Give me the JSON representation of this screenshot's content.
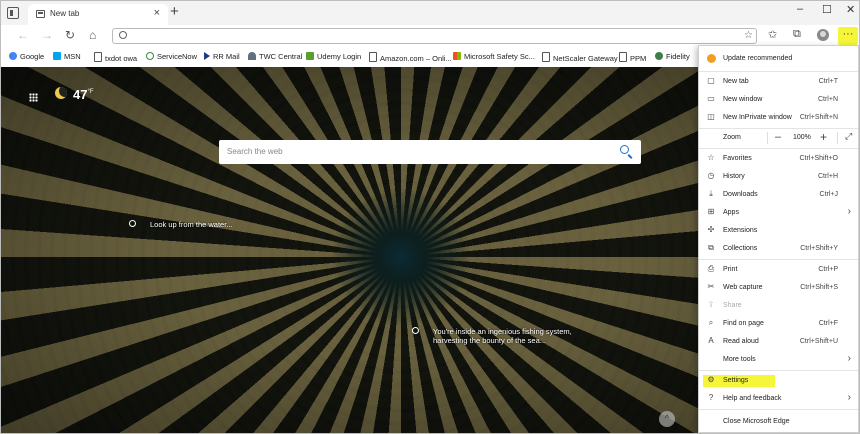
{
  "browser": {
    "tab_title": "New tab",
    "tab_close": "×",
    "new_tab": "+",
    "window_controls": {
      "minimize": "–",
      "maximize": "☐",
      "close": "✕"
    },
    "nav": {
      "back": "←",
      "forward": "→",
      "refresh": "↻",
      "home": "⌂"
    },
    "more_button": "···"
  },
  "favorites": [
    {
      "label": "Google",
      "color": "#4285f4"
    },
    {
      "label": "MSN",
      "color": "#00a4ef"
    },
    {
      "label": "txdot owa",
      "color": "#ffffff"
    },
    {
      "label": "ServiceNow",
      "color": "#62d84e"
    },
    {
      "label": "RR Mail",
      "color": "#1e3a8a"
    },
    {
      "label": "TWC Central",
      "color": "#607080"
    },
    {
      "label": "Udemy Login",
      "color": "#5a9e2e"
    },
    {
      "label": "Amazon.com – Onli...",
      "color": "#ffffff"
    },
    {
      "label": "Microsoft Safety Sc...",
      "color": "#f25022"
    },
    {
      "label": "NetScaler Gateway",
      "color": "#ffffff"
    },
    {
      "label": "PPM",
      "color": "#ffffff"
    },
    {
      "label": "Fidelity",
      "color": "#3f7d4a"
    }
  ],
  "newtab": {
    "temperature": "47",
    "temp_unit": "°F",
    "search_placeholder": "Search the web",
    "hotspot_1": "Look up from the water...",
    "hotspot_2_line1": "You're inside an ingenious fishing system,",
    "hotspot_2_line2": "harvesting the bounty of the sea...",
    "scroll_up": "^"
  },
  "menu": {
    "update": "Update recommended",
    "new_tab": {
      "label": "New tab",
      "shortcut": "Ctrl+T"
    },
    "new_window": {
      "label": "New window",
      "shortcut": "Ctrl+N"
    },
    "new_inprivate": {
      "label": "New InPrivate window",
      "shortcut": "Ctrl+Shift+N"
    },
    "zoom": {
      "label": "Zoom",
      "value": "100%"
    },
    "favorites": {
      "label": "Favorites",
      "shortcut": "Ctrl+Shift+O"
    },
    "history": {
      "label": "History",
      "shortcut": "Ctrl+H"
    },
    "downloads": {
      "label": "Downloads",
      "shortcut": "Ctrl+J"
    },
    "apps": {
      "label": "Apps"
    },
    "extensions": {
      "label": "Extensions"
    },
    "collections": {
      "label": "Collections",
      "shortcut": "Ctrl+Shift+Y"
    },
    "print": {
      "label": "Print",
      "shortcut": "Ctrl+P"
    },
    "web_capture": {
      "label": "Web capture",
      "shortcut": "Ctrl+Shift+S"
    },
    "share": {
      "label": "Share"
    },
    "find": {
      "label": "Find on page",
      "shortcut": "Ctrl+F"
    },
    "read_aloud": {
      "label": "Read aloud",
      "shortcut": "Ctrl+Shift+U"
    },
    "more_tools": {
      "label": "More tools"
    },
    "settings": {
      "label": "Settings"
    },
    "help": {
      "label": "Help and feedback"
    },
    "close": {
      "label": "Close Microsoft Edge"
    }
  },
  "colors": {
    "highlight": "#f5f53a",
    "accent": "#1a73c9"
  }
}
